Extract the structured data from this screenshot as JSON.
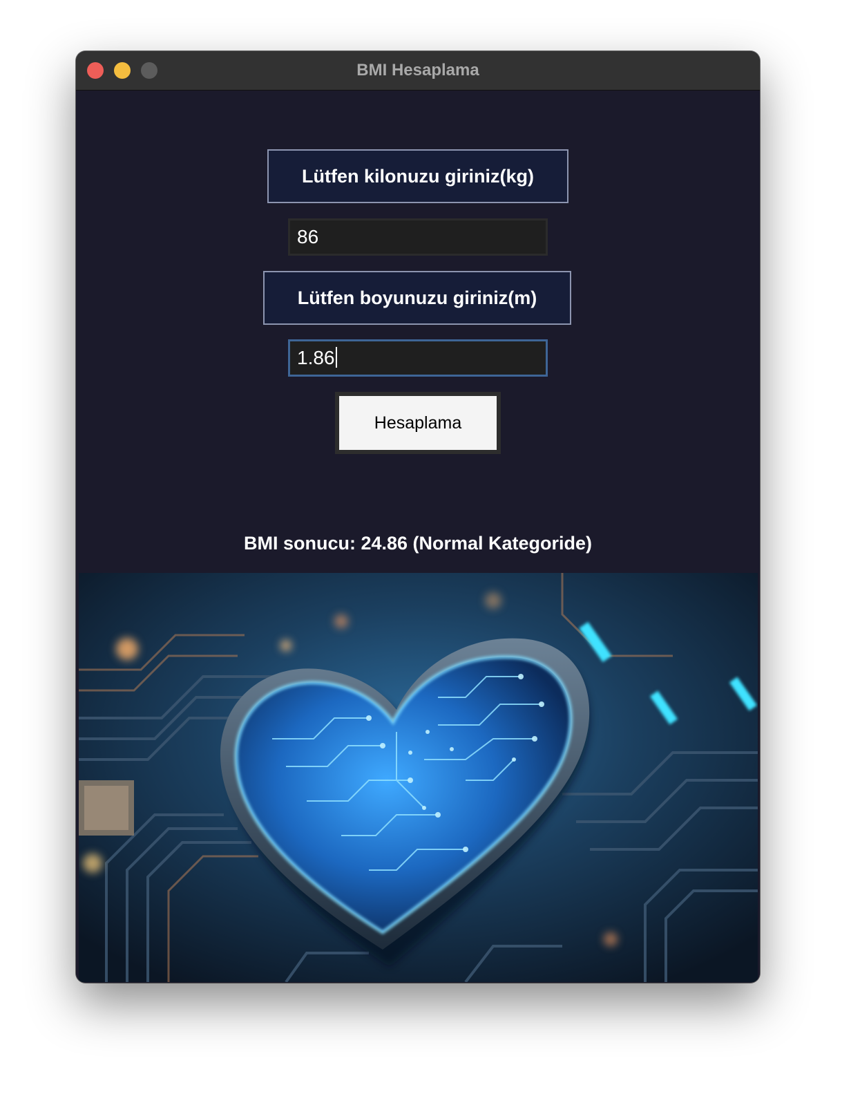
{
  "window": {
    "title": "BMI Hesaplama"
  },
  "form": {
    "weight_label": "Lütfen kilonuzu giriniz(kg)",
    "weight_value": "86",
    "height_label": "Lütfen boyunuzu giriniz(m)",
    "height_value": "1.86",
    "calculate_button": "Hesaplama"
  },
  "result": {
    "text": "BMI sonucu: 24.86 (Normal Kategoride)"
  },
  "image": {
    "subject": "glowing blue circuit-board heart on a dark circuit board"
  },
  "colors": {
    "background": "#1b1a2b",
    "label_bg": "#161d38",
    "label_border": "#8d95b0",
    "focus_border": "#3e6596",
    "titlebar": "#323232"
  }
}
